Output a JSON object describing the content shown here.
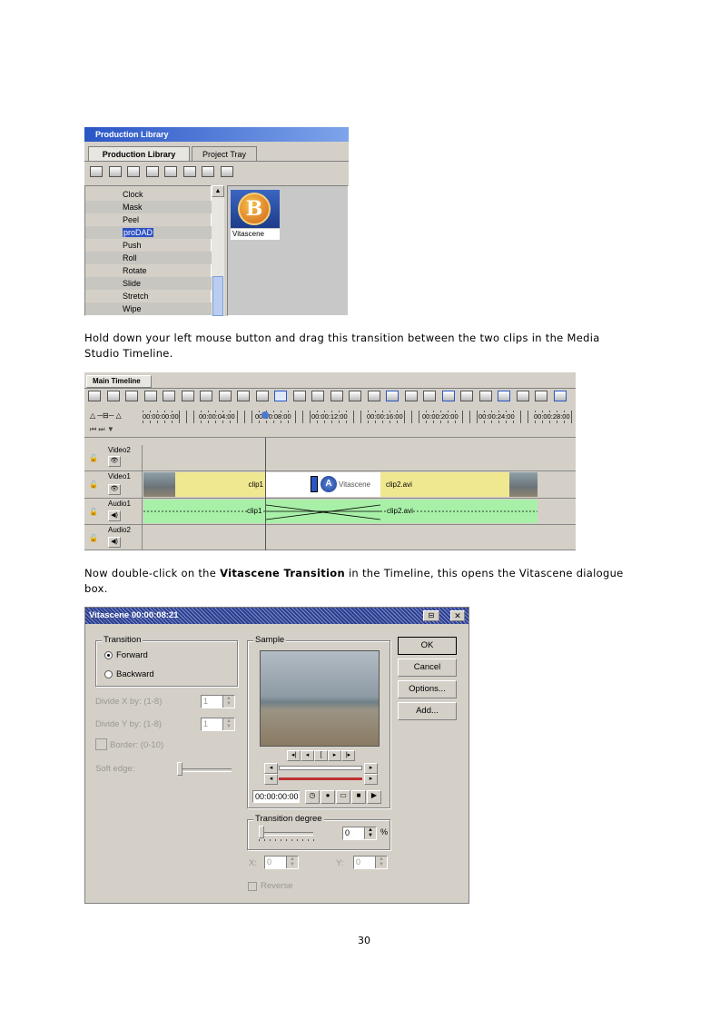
{
  "production_library": {
    "window_title": "Production Library",
    "tabs": [
      {
        "label": "Production Library"
      },
      {
        "label": "Project Tray"
      }
    ],
    "toolbar_icons": [
      "list-view-icon",
      "details-view-icon",
      "transition-icon",
      "effect-icon",
      "media-icon",
      "image-icon",
      "record-icon",
      "timecode-icon"
    ],
    "categories": [
      {
        "label": "Clock"
      },
      {
        "label": "Mask"
      },
      {
        "label": "Peel"
      },
      {
        "label": "proDAD",
        "selected": true
      },
      {
        "label": "Push"
      },
      {
        "label": "Roll"
      },
      {
        "label": "Rotate"
      },
      {
        "label": "Slide"
      },
      {
        "label": "Stretch"
      },
      {
        "label": "Wipe"
      }
    ],
    "thumbnail": {
      "logo_letter": "B",
      "label": "Vitascene"
    }
  },
  "para1": "Hold down your left mouse button and drag this transition between the two clips in the Media Studio Timeline.",
  "timeline": {
    "tab": "Main Timeline",
    "timecodes": [
      "00:00:00:00",
      "00:00:04:00",
      "00:00:08:00",
      "00:00:12:00",
      "00:00:16:00",
      "00:00:20:00",
      "00:00:24:00",
      "00:00:28:00"
    ],
    "tracks": [
      {
        "label": "Video2"
      },
      {
        "label": "Video1"
      },
      {
        "label": "Audio1"
      },
      {
        "label": "Audio2"
      }
    ],
    "clips": {
      "video_clip1": "clip1",
      "transition": "Vitascene",
      "video_clip2": "clip2.avi",
      "audio_clip1": "clip1",
      "audio_clip2": "clip2.avi"
    },
    "transition_badge": "A"
  },
  "para2_before": "Now double-click on the ",
  "para2_bold": "Vitascene Transition",
  "para2_after": " in the Timeline, this opens the Vitascene dialogue box.",
  "dialog": {
    "title": "Vitascene 00:00:08:21",
    "transition_group": "Transition",
    "radio_forward": "Forward",
    "radio_backward": "Backward",
    "divide_x_label": "Divide X by: (1-8)",
    "divide_x_value": "1",
    "divide_y_label": "Divide Y by: (1-8)",
    "divide_y_value": "1",
    "border_label": "Border: (0-10)",
    "soft_edge_label": "Soft edge:",
    "sample_group": "Sample",
    "timecode": "00:00:00:00",
    "buttons": {
      "ok": "OK",
      "cancel": "Cancel",
      "options": "Options...",
      "add": "Add..."
    },
    "transition_degree_group": "Transition degree",
    "degree_value": "0",
    "degree_unit": "%",
    "x_label": "X:",
    "x_value": "0",
    "y_label": "Y:",
    "y_value": "0",
    "reverse_label": "Reverse"
  },
  "page_number": "30"
}
